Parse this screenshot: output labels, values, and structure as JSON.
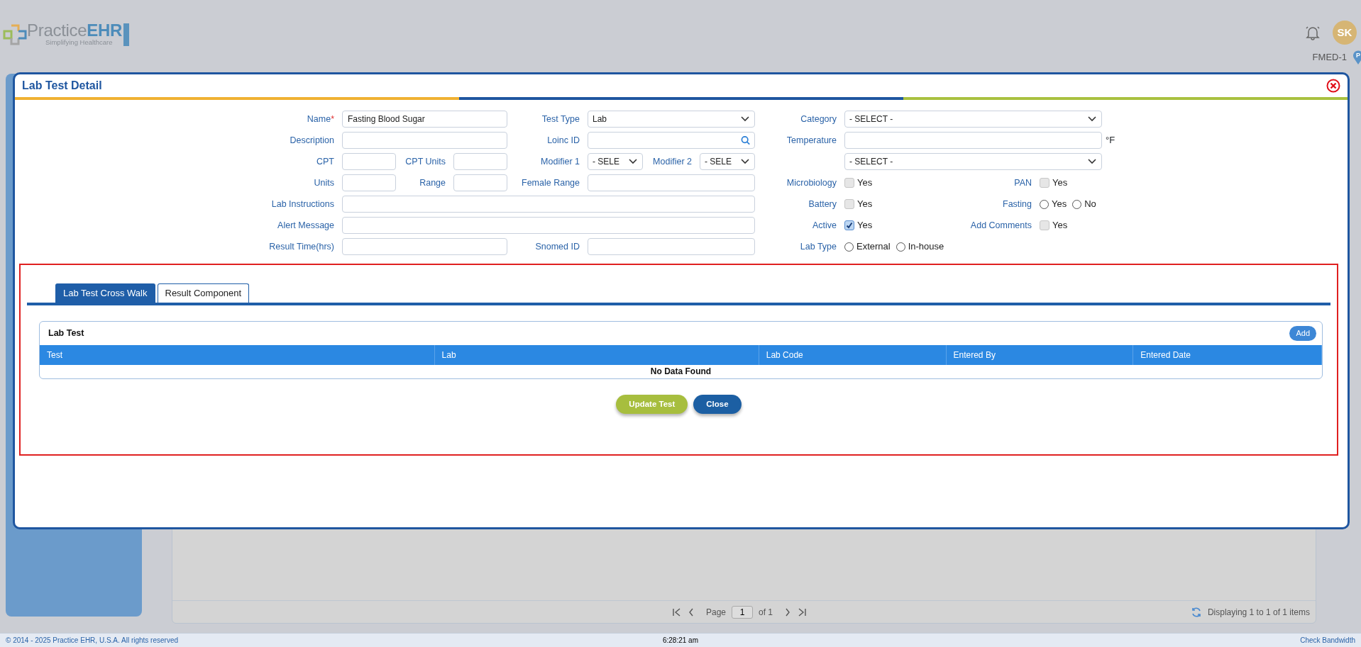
{
  "app": {
    "logo_text": "Practice",
    "logo_text_strong": "EHR",
    "tagline": "Simplifying Healthcare",
    "user_initials": "SK",
    "facility": "FMED-1",
    "pin_letter": "P"
  },
  "modal": {
    "title": "Lab Test Detail",
    "form_rows": [
      [
        {
          "label": "Name",
          "required_mark": "*",
          "control": {
            "kind": "text",
            "value": "Fasting Blood Sugar"
          }
        },
        {
          "label": "Test Type",
          "control": {
            "kind": "select",
            "value": "Lab"
          }
        },
        {
          "label": "Category",
          "control": {
            "kind": "select",
            "value": "- SELECT -"
          }
        }
      ],
      [
        {
          "label": "Description",
          "control": {
            "kind": "text"
          }
        },
        {
          "label": "Loinc ID",
          "control": {
            "kind": "search"
          }
        },
        {
          "label": "Temperature",
          "control": {
            "kind": "text",
            "unit": "°F"
          }
        }
      ],
      [
        {
          "label": "CPT",
          "control": {
            "kind": "text"
          }
        },
        {
          "label": "CPT Units",
          "control": {
            "kind": "text"
          }
        },
        {
          "label": "Modifier 1",
          "control": {
            "kind": "select",
            "value": "- SELE"
          }
        },
        {
          "label": "Modifier 2",
          "control": {
            "kind": "select",
            "value": "- SELE"
          }
        },
        {
          "control": {
            "kind": "select",
            "value": "- SELECT -"
          }
        }
      ],
      [
        {
          "label": "Units",
          "control": {
            "kind": "text"
          }
        },
        {
          "label": "Range",
          "control": {
            "kind": "text"
          }
        },
        {
          "label": "Female Range",
          "control": {
            "kind": "text"
          }
        },
        {
          "label": "Microbiology",
          "control": {
            "kind": "checkbox",
            "checked": false,
            "option": "Yes"
          }
        },
        {
          "label": "PAN",
          "control": {
            "kind": "checkbox",
            "checked": false,
            "option": "Yes"
          }
        }
      ],
      [
        {
          "label": "Lab Instructions",
          "control": {
            "kind": "text"
          }
        },
        {
          "label": "Battery",
          "control": {
            "kind": "checkbox",
            "checked": false,
            "option": "Yes"
          }
        },
        {
          "label": "Fasting",
          "control": {
            "kind": "radio",
            "options": [
              {
                "label": "Yes",
                "selected": false
              },
              {
                "label": "No",
                "selected": false
              }
            ]
          }
        }
      ],
      [
        {
          "label": "Alert Message",
          "control": {
            "kind": "text"
          }
        },
        {
          "label": "Active",
          "control": {
            "kind": "checkbox",
            "checked": true,
            "option": "Yes"
          }
        },
        {
          "label": "Add Comments",
          "control": {
            "kind": "checkbox",
            "checked": false,
            "option": "Yes"
          }
        }
      ],
      [
        {
          "label": "Result Time(hrs)",
          "control": {
            "kind": "text"
          }
        },
        {
          "label": "Snomed ID",
          "control": {
            "kind": "text"
          }
        },
        {
          "label": "Lab Type",
          "control": {
            "kind": "radio",
            "options": [
              {
                "label": "External",
                "selected": false
              },
              {
                "label": "In-house",
                "selected": false
              }
            ]
          }
        }
      ]
    ],
    "tabs": [
      {
        "label": "Lab Test Cross Walk",
        "selected": true
      },
      {
        "label": "Result Component",
        "selected": false
      }
    ],
    "grid": {
      "title": "Lab Test",
      "add_button": "Add",
      "columns": [
        "Test",
        "Lab",
        "Lab Code",
        "Entered By",
        "Entered Date"
      ],
      "empty_message": "No Data Found"
    },
    "buttons": [
      {
        "label": "Update Test",
        "kind": "primary"
      },
      {
        "label": "Close",
        "kind": "secondary"
      }
    ]
  },
  "pager": {
    "page_label": "Page",
    "page": "1",
    "of_text": "of 1",
    "summary": "Displaying 1 to 1 of 1 items"
  },
  "footer": {
    "copyright": "© 2014 - 2025 Practice EHR, U.S.A. All rights reserved",
    "time": "6:28:21 am",
    "link": "Check Bandwidth"
  }
}
